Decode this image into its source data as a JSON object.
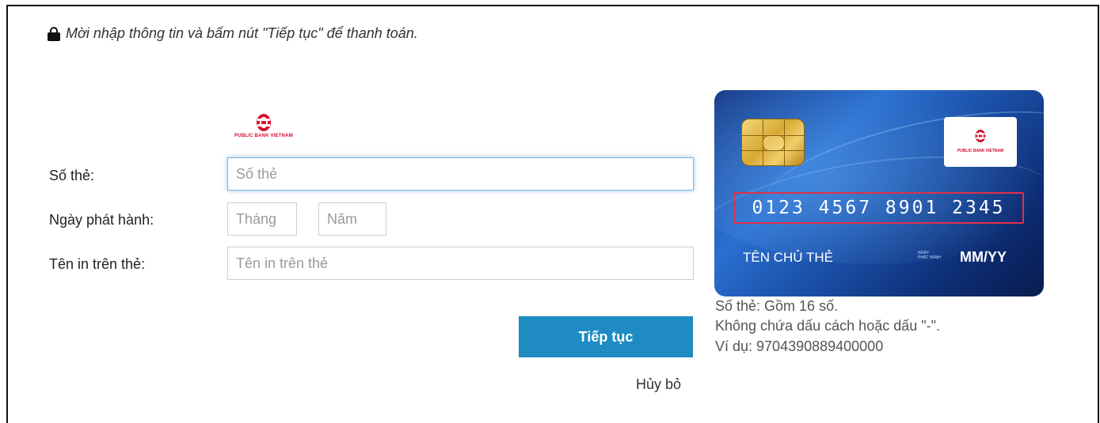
{
  "notice": {
    "text": "Mời nhập thông tin và bấm nút \"Tiếp tục\" để thanh toán."
  },
  "bank": {
    "name": "PUBLIC BANK VIETNAM",
    "brand_color": "#d3102a"
  },
  "form": {
    "card_number": {
      "label": "Số thẻ:",
      "placeholder": "Số thẻ",
      "value": ""
    },
    "issue_date": {
      "label": "Ngày phát hành:",
      "month_placeholder": "Tháng",
      "year_placeholder": "Năm"
    },
    "holder_name": {
      "label": "Tên in trên thẻ:",
      "placeholder": "Tên in trên thẻ",
      "value": ""
    },
    "continue_label": "Tiếp tục",
    "cancel_label": "Hủy bỏ",
    "accent_color": "#1e8bc3"
  },
  "card_preview": {
    "number": "0123 4567 8901 2345",
    "holder": "TÊN CHỦ THẺ",
    "issue_label_line1": "NGÀY",
    "issue_label_line2": "PHÁT HÀNH",
    "expiry": "MM/YY"
  },
  "hints": [
    "Số thẻ: Gồm 16 số.",
    "Không chứa dấu cách hoặc dấu \"-\".",
    "Ví dụ: 9704390889400000"
  ]
}
